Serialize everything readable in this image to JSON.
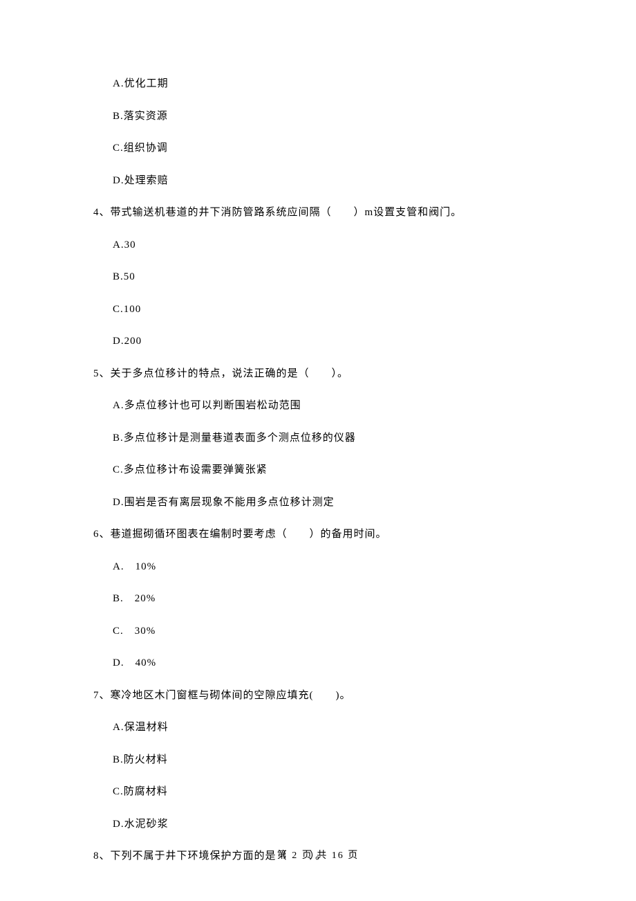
{
  "q3_options": {
    "a": "A.优化工期",
    "b": "B.落实资源",
    "c": "C.组织协调",
    "d": "D.处理索赔"
  },
  "q4": {
    "text": "4、带式输送机巷道的井下消防管路系统应间隔（　　）m设置支管和阀门。",
    "options": {
      "a": "A.30",
      "b": "B.50",
      "c": "C.100",
      "d": "D.200"
    }
  },
  "q5": {
    "text": "5、关于多点位移计的特点，说法正确的是（　　）。",
    "options": {
      "a": "A.多点位移计也可以判断围岩松动范围",
      "b": "B.多点位移计是测量巷道表面多个测点位移的仪器",
      "c": "C.多点位移计布设需要弹簧张紧",
      "d": "D.围岩是否有离层现象不能用多点位移计测定"
    }
  },
  "q6": {
    "text": "6、巷道掘砌循环图表在编制时要考虑（　　）的备用时间。",
    "options": {
      "a": "A.　10%",
      "b": "B.　20%",
      "c": "C.　30%",
      "d": "D.　40%"
    }
  },
  "q7": {
    "text": "7、寒冷地区木门窗框与砌体间的空隙应填充(　　)。",
    "options": {
      "a": "A.保温材料",
      "b": "B.防火材料",
      "c": "C.防腐材料",
      "d": "D.水泥砂浆"
    }
  },
  "q8": {
    "text": "8、下列不属于井下环境保护方面的是（　　）。"
  },
  "footer": "第 2 页 共 16 页"
}
